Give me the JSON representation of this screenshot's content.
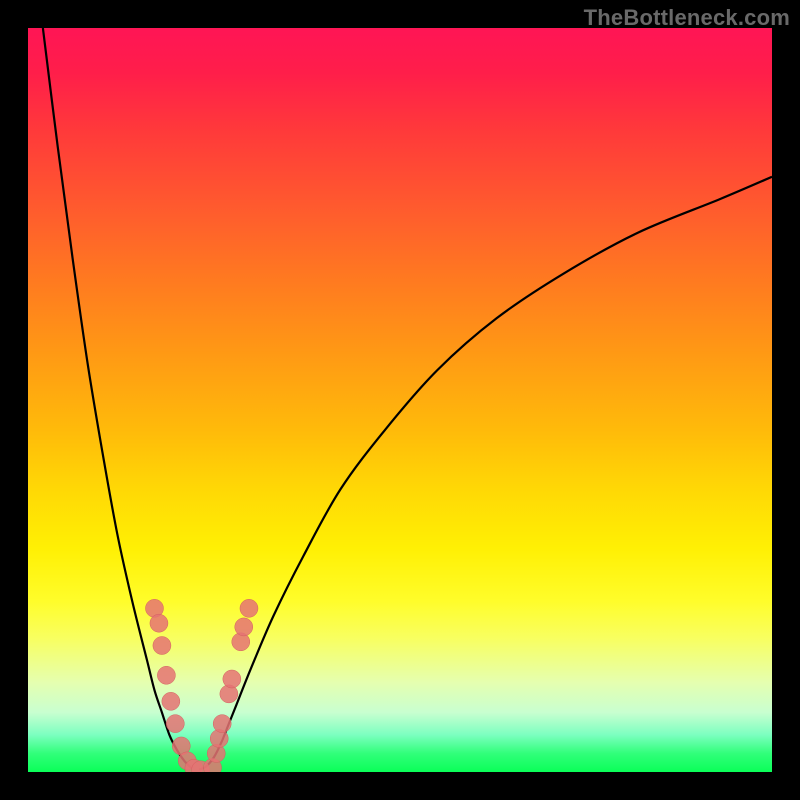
{
  "watermark": "TheBottleneck.com",
  "chart_data": {
    "type": "line",
    "title": "",
    "xlabel": "",
    "ylabel": "",
    "x_range": [
      0,
      100
    ],
    "y_range": [
      0,
      100
    ],
    "grid": false,
    "legend": false,
    "note": "Bottleneck deviation curve; values are percentages (x = relative component ratio, y = bottleneck %). Estimated from plot.",
    "series": [
      {
        "name": "left-branch",
        "x": [
          2,
          4,
          6,
          8,
          10,
          12,
          14,
          16,
          17,
          18,
          19,
          20,
          21,
          22
        ],
        "y": [
          100,
          84,
          69,
          55,
          43,
          32,
          23,
          15,
          11,
          8,
          5,
          3,
          1.5,
          0.5
        ]
      },
      {
        "name": "right-branch",
        "x": [
          23,
          24,
          25,
          26,
          27,
          28,
          30,
          33,
          37,
          42,
          48,
          55,
          63,
          72,
          82,
          93,
          100
        ],
        "y": [
          0.3,
          0.8,
          2,
          4,
          6.5,
          9,
          14,
          21,
          29,
          38,
          46,
          54,
          61,
          67,
          72.5,
          77,
          80
        ]
      }
    ],
    "highlight_points": {
      "name": "near-optimal-cluster",
      "points": [
        {
          "x": 17.0,
          "y": 22.0
        },
        {
          "x": 17.6,
          "y": 20.0
        },
        {
          "x": 18.0,
          "y": 17.0
        },
        {
          "x": 18.6,
          "y": 13.0
        },
        {
          "x": 19.2,
          "y": 9.5
        },
        {
          "x": 19.8,
          "y": 6.5
        },
        {
          "x": 20.6,
          "y": 3.5
        },
        {
          "x": 21.4,
          "y": 1.5
        },
        {
          "x": 22.3,
          "y": 0.5
        },
        {
          "x": 23.2,
          "y": 0.3
        },
        {
          "x": 24.8,
          "y": 0.6
        },
        {
          "x": 25.3,
          "y": 2.5
        },
        {
          "x": 25.7,
          "y": 4.5
        },
        {
          "x": 26.1,
          "y": 6.5
        },
        {
          "x": 27.0,
          "y": 10.5
        },
        {
          "x": 27.4,
          "y": 12.5
        },
        {
          "x": 28.6,
          "y": 17.5
        },
        {
          "x": 29.0,
          "y": 19.5
        },
        {
          "x": 29.7,
          "y": 22.0
        }
      ]
    },
    "background_gradient": {
      "direction": "vertical",
      "stops": [
        {
          "pos": 0.0,
          "color": "#ff1555"
        },
        {
          "pos": 0.5,
          "color": "#ffba0a"
        },
        {
          "pos": 0.8,
          "color": "#fcff40"
        },
        {
          "pos": 1.0,
          "color": "#0aff58"
        }
      ]
    }
  }
}
